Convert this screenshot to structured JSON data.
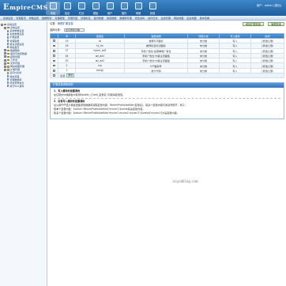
{
  "header": {
    "logo": "EmpireCMS",
    "logo_first": "E",
    "logo_rest": "mpireCMS",
    "user_label": "用户：admin  [退出]",
    "nav": [
      {
        "label": "系统",
        "icon": "gear-icon",
        "active": true
      },
      {
        "label": "信息",
        "icon": "document-icon",
        "active": false
      },
      {
        "label": "栏目",
        "icon": "folder-icon",
        "active": false
      },
      {
        "label": "模板",
        "icon": "template-icon",
        "active": false
      },
      {
        "label": "用户",
        "icon": "user-icon",
        "active": false
      },
      {
        "label": "插件",
        "icon": "plugin-icon",
        "active": false
      },
      {
        "label": "商城",
        "icon": "cart-icon",
        "active": false
      },
      {
        "label": "其他",
        "icon": "more-icon",
        "active": false
      }
    ]
  },
  "menubar": [
    "系统设置",
    "管理首页",
    "参数设置",
    "数据更新",
    "管理模型",
    "管理专题",
    "管理标签",
    "备份数据",
    "恢复数据",
    "数据库管理",
    "修改资料",
    "操作日志",
    "在线管理",
    "网站地图",
    "后台地图",
    "版本查看"
  ],
  "sidebar": {
    "items": [
      {
        "label": "系统设置",
        "level": 0,
        "type": "folder",
        "toggle": "-"
      },
      {
        "label": "系统设置",
        "level": 1,
        "type": "folder",
        "toggle": "-"
      },
      {
        "label": "系统参数设置",
        "level": 2,
        "type": "page"
      },
      {
        "label": "系统参数设置",
        "level": 2,
        "type": "page"
      },
      {
        "label": "扩展变量",
        "level": 2,
        "type": "page"
      },
      {
        "label": "管理变量",
        "level": 2,
        "type": "page"
      },
      {
        "label": "前台功能设置",
        "level": 2,
        "type": "page"
      },
      {
        "label": "网站首页",
        "level": 2,
        "type": "page"
      },
      {
        "label": "数据更新",
        "level": 1,
        "type": "folder",
        "toggle": "+"
      },
      {
        "label": "备份与恢复数据",
        "level": 1,
        "type": "folder",
        "toggle": "+"
      },
      {
        "label": "模型管理",
        "level": 1,
        "type": "folder",
        "toggle": "+"
      },
      {
        "label": "工作流",
        "level": 1,
        "type": "folder",
        "toggle": "+"
      },
      {
        "label": "文件管理",
        "level": 1,
        "type": "folder",
        "toggle": "+"
      },
      {
        "label": "网站地图管理",
        "level": 1,
        "type": "folder",
        "toggle": "+"
      },
      {
        "label": "扩展管理",
        "level": 1,
        "type": "folder",
        "toggle": "-"
      },
      {
        "label": "显示JS生成",
        "level": 2,
        "type": "page"
      },
      {
        "label": "静态页面",
        "level": 2,
        "type": "page"
      },
      {
        "label": "管理数据库",
        "level": 2,
        "type": "page"
      },
      {
        "label": "修改登录信息",
        "level": 2,
        "type": "page"
      },
      {
        "label": "执行SQL语句",
        "level": 2,
        "type": "page"
      }
    ]
  },
  "content": {
    "position_prefix": "位置：",
    "position_link": "管理扩展变量",
    "btn_add": "增加扩展变量",
    "btn_manage": "管理变量",
    "filter_label": "选择分类：",
    "filter_value": "显示所有分类",
    "table": {
      "headers": [
        "",
        "ID",
        "变量名",
        "变量说明",
        "所属分类",
        "写入缓存",
        "操作"
      ],
      "rows": [
        {
          "id": "19",
          "name": "ss",
          "desc": "搜索ICO图标",
          "category": "未分类",
          "cache": "写入",
          "ops": "[修改] [删"
        },
        {
          "id": "18",
          "name": "ts_lm",
          "desc": "推荐栏目标识图标",
          "category": "未分类",
          "cache": "写入",
          "ops": "[修改] [删"
        },
        {
          "id": "37",
          "name": "home_ad1",
          "desc": "手机广告位·最旁单侧广告位",
          "category": "未分类",
          "cache": "写入",
          "ops": "[修改] [删"
        },
        {
          "id": "34",
          "name": "wz_ad1",
          "desc": "手机广告位·内容主页面板",
          "category": "未分类",
          "cache": "写入",
          "ops": "[修改] [删"
        },
        {
          "id": "30",
          "name": "wz_ad2",
          "desc": "手机广告位·内容主页面板",
          "category": "未分类",
          "cache": "写入",
          "ops": "[修改] [删"
        },
        {
          "id": "2",
          "name": "icp",
          "desc": "ICP备案号",
          "category": "未分类",
          "cache": "写入",
          "ops": "[修改] [删"
        },
        {
          "id": "1",
          "name": "tongji",
          "desc": "统计代码",
          "category": "未分类",
          "cache": "写入",
          "ops": "[修改] [删"
        }
      ],
      "footer_select": "全选",
      "footer_delete": "删除"
    },
    "help": {
      "title": "扩展变量调用说明",
      "lines": [
        {
          "text": "1．写入缓存的变量调用",
          "bold": true
        },
        {
          "text": "在任意php或模板中使用$public_r['add_变量名']可取得变量值。",
          "bold": false
        },
        {
          "text": "",
          "sep": true
        },
        {
          "text": "2．没有写入缓存的变量调用",
          "bold": true
        },
        {
          "text": "在以用PHP显示模板里面调用数据库读取变量内容：ReturnPublicAddVar(变量名)，取多个变量内容可用逗号隔开，例子：",
          "bold": false
        },
        {
          "text": "取单个变量内容：$value=ReturnPublicAddVar('myvar');$value就是变量内容。",
          "bold": false
        },
        {
          "text": "取多个变量内容：$value=ReturnPublicAddVar('myvar1,myvar2,myvar3');$value['myvar1']才是变量内容。",
          "bold": false
        }
      ]
    }
  },
  "watermark": "ecyndblog.com",
  "watermark_sub": "ecyndblog.com"
}
